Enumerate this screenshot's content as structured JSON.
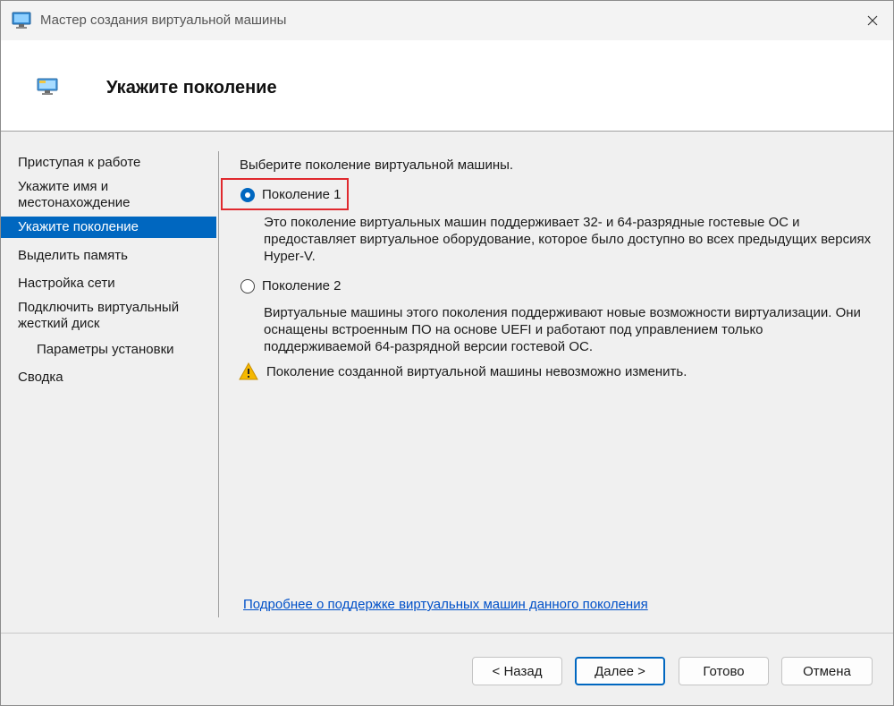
{
  "window": {
    "title": "Мастер создания виртуальной машины",
    "header_title": "Укажите поколение"
  },
  "sidebar": {
    "items": [
      {
        "label": "Приступая к работе"
      },
      {
        "label": "Укажите имя и местонахождение"
      },
      {
        "label": "Укажите поколение",
        "active": true
      },
      {
        "label": "Выделить память"
      },
      {
        "label": "Настройка сети"
      },
      {
        "label": "Подключить виртуальный жесткий диск"
      },
      {
        "label": "Параметры установки",
        "sub": true
      },
      {
        "label": "Сводка"
      }
    ]
  },
  "content": {
    "prompt": "Выберите поколение виртуальной машины.",
    "gen1": {
      "label": "Поколение 1",
      "checked": true,
      "description": "Это поколение виртуальных машин поддерживает 32- и 64-разрядные гостевые ОС и предоставляет виртуальное оборудование, которое было доступно во всех предыдущих версиях Hyper-V."
    },
    "gen2": {
      "label": "Поколение 2",
      "checked": false,
      "description": "Виртуальные машины этого поколения поддерживают новые возможности виртуализации. Они оснащены встроенным ПО на основе UEFI и работают под управлением только поддерживаемой 64-разрядной версии гостевой ОС."
    },
    "warning": "Поколение созданной виртуальной машины невозможно изменить.",
    "more_link": "Подробнее о поддержке виртуальных машин данного поколения"
  },
  "buttons": {
    "back": "< Назад",
    "next": "Далее >",
    "finish": "Готово",
    "cancel": "Отмена"
  },
  "colors": {
    "accent": "#0067c0",
    "highlight": "#e0292e",
    "link": "#0050c8",
    "warning": "#f5b800"
  }
}
